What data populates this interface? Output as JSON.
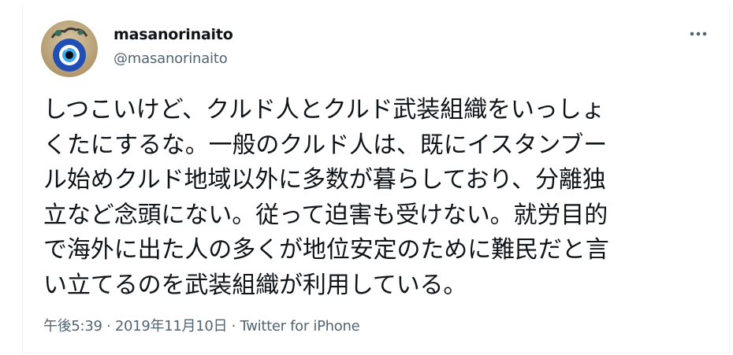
{
  "tweet": {
    "author": {
      "display_name": "masanorinaito",
      "handle": "@masanorinaito",
      "avatar_icon": "nazar-evil-eye-icon"
    },
    "more_icon": "more-horizontal-icon",
    "text_lines": [
      "しつこいけど、クルド人とクルド武装組織をいっしょ",
      "くたにするな。一般のクルド人は、既にイスタンブー",
      "ル始めクルド地域以外に多数が暮らしており、分離独",
      "立など念頭にない。従って迫害も受けない。就労目的",
      "で海外に出た人の多くが地位安定のために難民だと言",
      "い立てるのを武装組織が利用している。"
    ],
    "meta": {
      "time": "午後5:39",
      "separator": " · ",
      "date": "2019年11月10日",
      "source": "Twitter for iPhone"
    }
  },
  "colors": {
    "text_primary": "#0f1419",
    "text_secondary": "#536471",
    "border": "#eff3f4"
  }
}
